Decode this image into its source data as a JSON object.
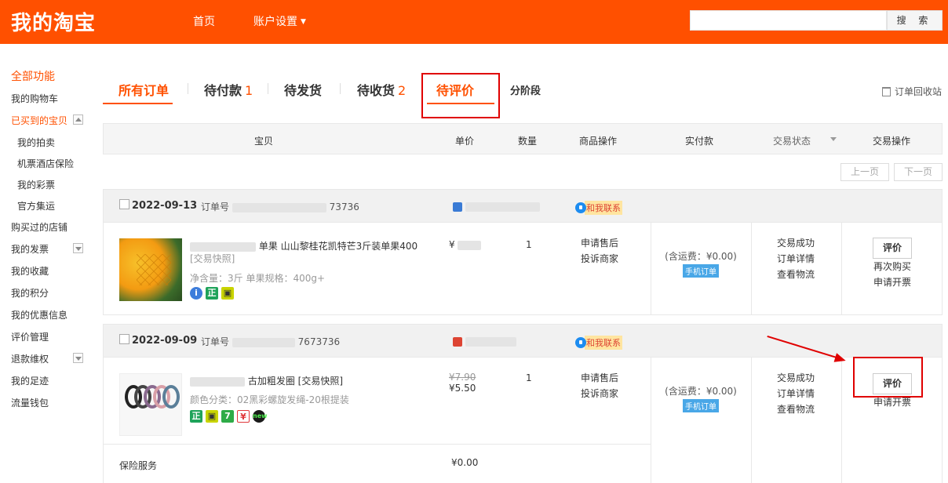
{
  "header": {
    "logo": "我的淘宝",
    "nav": {
      "home": "首页",
      "account": "账户设置"
    },
    "search_button": "搜 索",
    "search_value": ""
  },
  "sidebar": {
    "all_functions": "全部功能",
    "cart": "我的购物车",
    "bought": "已买到的宝贝",
    "auction": "我的拍卖",
    "flight_hotel": "机票酒店保险",
    "lottery": "我的彩票",
    "official_collect": "官方集运",
    "shops_bought": "购买过的店铺",
    "invoice": "我的发票",
    "favorites": "我的收藏",
    "points": "我的积分",
    "coupons": "我的优惠信息",
    "reviews": "评价管理",
    "refunds": "退款维权",
    "footprints": "我的足迹",
    "data_wallet": "流量钱包"
  },
  "tabs": {
    "all": "所有订单",
    "to_pay": "待付款",
    "to_pay_count": "1",
    "to_ship": "待发货",
    "to_receive": "待收货",
    "to_receive_count": "2",
    "to_review": "待评价",
    "installment": "分阶段",
    "recycle": "订单回收站"
  },
  "columns": {
    "item": "宝贝",
    "unit_price": "单价",
    "quantity": "数量",
    "item_ops": "商品操作",
    "paid": "实付款",
    "status": "交易状态",
    "actions": "交易操作"
  },
  "pager": {
    "prev": "上一页",
    "next": "下一页"
  },
  "orders": [
    {
      "date": "2022-09-13",
      "order_no_label": "订单号",
      "order_no_visible": "73736",
      "contact": "和我联系",
      "title": "单果 山山黎桂花凯特芒3斤装单果400",
      "title_sub": "[交易快照]",
      "spec": "净含量：3斤  单果规格：400g+",
      "price": "¥",
      "qty": "1",
      "item_ops": [
        "申请售后",
        "投诉商家"
      ],
      "paid_amount": "",
      "paid_shipping": "(含运费：¥0.00)",
      "paid_channel": "手机订单",
      "status_lines": [
        "交易成功",
        "订单详情",
        "查看物流"
      ],
      "rate_button": "评价",
      "action_lines": [
        "再次购买",
        "申请开票"
      ]
    },
    {
      "date": "2022-09-09",
      "order_no_label": "订单号",
      "order_no_visible": "7673736",
      "contact": "和我联系",
      "title": "古加粗发圈 [交易快照]",
      "spec": "颜色分类：02黑彩螺旋发绳-20根提装",
      "price_old": "¥7.90",
      "price": "¥5.50",
      "qty": "1",
      "item_ops": [
        "申请售后",
        "投诉商家"
      ],
      "paid_amount": "",
      "paid_shipping": "(含运费：¥0.00)",
      "paid_channel": "手机订单",
      "status_lines": [
        "交易成功",
        "订单详情",
        "查看物流"
      ],
      "rate_button": "评价",
      "action_lines": [
        "申请开票"
      ],
      "insurance": "保险服务",
      "insurance_price": "¥0.00"
    }
  ],
  "colors": {
    "brand": "#ff5000",
    "annotation": "#e00000"
  }
}
